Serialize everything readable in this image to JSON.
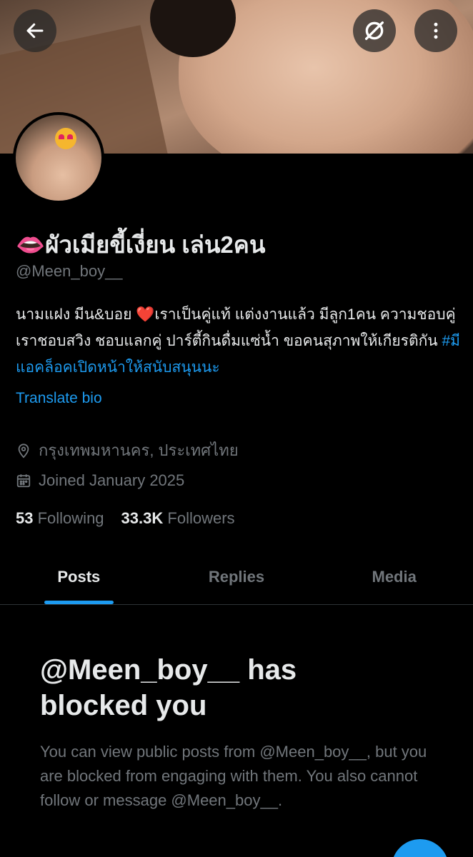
{
  "profile": {
    "display_name": "👄ผัวเมียขี้เงี่ยน เล่น2คน",
    "handle": "@Meen_boy__",
    "bio_text": "นามแฝง มีน&บอย ❤️เราเป็นคู่แท้ แต่งงานแล้ว มีลูก1คน ความชอบคู่เราชอบสวิง ชอบแลกคู่ ปาร์ตี้กินดื่มแซ่น้ำ ขอคนสุภาพให้เกียรติกัน ",
    "bio_hashtag": "#มีแอคล็อคเปิดหน้าให้สนับสนุนนะ",
    "translate_label": "Translate bio",
    "location": "กรุงเทพมหานคร, ประเทศไทย",
    "joined": "Joined January 2025",
    "following_count": "53",
    "following_label": "Following",
    "followers_count": "33.3K",
    "followers_label": "Followers"
  },
  "tabs": [
    {
      "label": "Posts",
      "active": true
    },
    {
      "label": "Replies",
      "active": false
    },
    {
      "label": "Media",
      "active": false
    }
  ],
  "blocked": {
    "title": "@Meen_boy__ has blocked you",
    "message": "You can view public posts from @Meen_boy__, but you are blocked from engaging with them. You also cannot follow or message @Meen_boy__."
  },
  "icons": {
    "back": "arrow-left-icon",
    "grok": "grok-icon",
    "more": "more-vertical-icon",
    "location": "location-pin-icon",
    "calendar": "calendar-icon"
  },
  "colors": {
    "background": "#000000",
    "text_primary": "#e7e9ea",
    "text_secondary": "#71767b",
    "accent": "#1d9bf0",
    "divider": "#2f3336"
  }
}
